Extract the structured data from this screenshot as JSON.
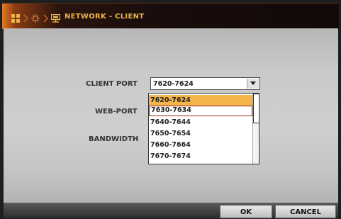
{
  "header": {
    "title": "NETWORK - CLIENT",
    "breadcrumb_icons": [
      "grid-icon",
      "gear-icon",
      "monitor-network-icon"
    ]
  },
  "form": {
    "client_port_label": "CLIENT PORT",
    "web_port_label": "WEB-PORT",
    "bandwidth_label": "BANDWIDTH",
    "client_port_value": "7620-7624"
  },
  "dropdown": {
    "options": [
      "7620-7624",
      "7630-7634",
      "7640-7644",
      "7650-7654",
      "7660-7664",
      "7670-7674"
    ],
    "selected": "7620-7624",
    "highlighted": "7630-7634"
  },
  "buttons": {
    "ok": "OK",
    "cancel": "CANCEL"
  },
  "colors": {
    "accent_orange": "#e27a24",
    "title_text": "#e8b64a",
    "selected_option": "#f3b54a",
    "highlight_border": "#9a2a1a"
  }
}
